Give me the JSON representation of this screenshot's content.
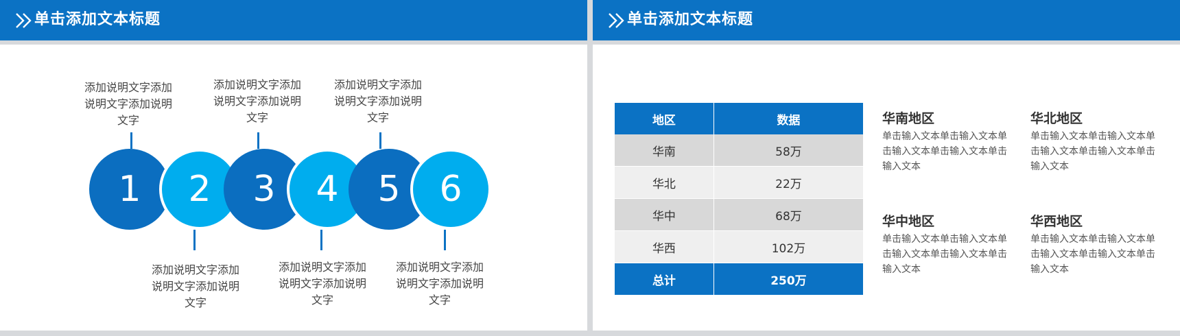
{
  "left": {
    "title": "单击添加文本标题",
    "steps": [
      {
        "number": "1",
        "caption": "添加说明文字添加说明文字添加说明文字"
      },
      {
        "number": "2",
        "caption": "添加说明文字添加说明文字添加说明文字"
      },
      {
        "number": "3",
        "caption": "添加说明文字添加说明文字添加说明文字"
      },
      {
        "number": "4",
        "caption": "添加说明文字添加说明文字添加说明文字"
      },
      {
        "number": "5",
        "caption": "添加说明文字添加说明文字添加说明文字"
      },
      {
        "number": "6",
        "caption": "添加说明文字添加说明文字添加说明文字"
      }
    ]
  },
  "right": {
    "title": "单击添加文本标题",
    "table": {
      "headers": [
        "地区",
        "数据"
      ],
      "rows": [
        [
          "华南",
          "58万"
        ],
        [
          "华北",
          "22万"
        ],
        [
          "华中",
          "68万"
        ],
        [
          "华西",
          "102万"
        ]
      ],
      "total": [
        "总计",
        "250万"
      ]
    },
    "regions": [
      {
        "title": "华南地区",
        "text": "单击输入文本单击输入文本单击输入文本单击输入文本单击输入文本"
      },
      {
        "title": "华北地区",
        "text": "单击输入文本单击输入文本单击输入文本单击输入文本单击输入文本"
      },
      {
        "title": "华中地区",
        "text": "单击输入文本单击输入文本单击输入文本单击输入文本单击输入文本"
      },
      {
        "title": "华西地区",
        "text": "单击输入文本单击输入文本单击输入文本单击输入文本单击输入文本"
      }
    ]
  },
  "colors": {
    "primary": "#0b72c4",
    "dark_circle": "#0b6ec0",
    "light_circle": "#00adee",
    "divider": "#d7d9dc"
  }
}
